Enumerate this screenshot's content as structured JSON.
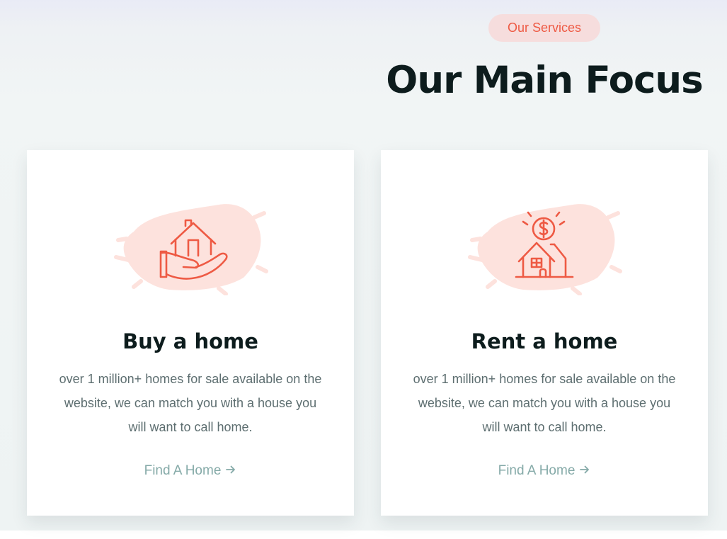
{
  "section": {
    "badge": "Our Services",
    "title": "Our Main Focus"
  },
  "cards": [
    {
      "icon": "hand-house-icon",
      "title": "Buy a home",
      "description": "over 1 million+ homes for sale available on the website, we can match you with a house you will want to call home.",
      "link_label": "Find A Home"
    },
    {
      "icon": "house-dollar-icon",
      "title": "Rent a home",
      "description": "over 1 million+ homes for sale available on the website, we can match you with a house you will want to call home.",
      "link_label": "Find A Home"
    }
  ],
  "colors": {
    "accent": "#ee5a44",
    "badge_bg": "#f6dddd",
    "heading": "#0d1c1d",
    "body_text": "#5d6e70",
    "link": "#85aaa8",
    "icon_splash": "#fde2dd"
  }
}
